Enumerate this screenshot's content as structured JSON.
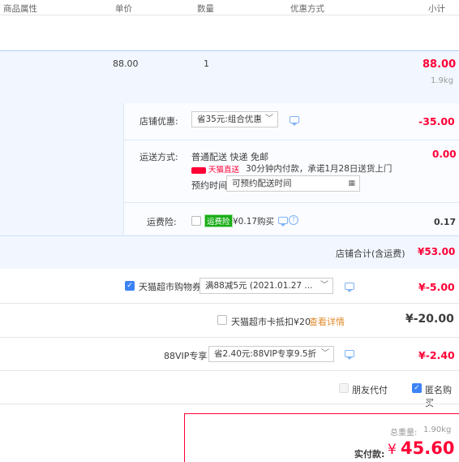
{
  "header": {
    "col_attr": "商品属性",
    "col_price": "单价",
    "col_qty": "数量",
    "col_promo": "优惠方式",
    "col_subtotal": "小计"
  },
  "item": {
    "price": "88.00",
    "qty": "1",
    "subtotal": "88.00",
    "weight": "1.9kg"
  },
  "shop": {
    "discount_label": "店铺优惠:",
    "discount_select": "省35元:组合优惠",
    "discount_amount": "-35.00",
    "shipping_label": "运送方式:",
    "shipping_text": "普通配送 快递 免邮",
    "shipping_amount": "0.00",
    "tmall_badge": "天猫直送",
    "tmall_text": "30分钟内付款，承诺1月28日送货上门",
    "reserve_label": "预约时间",
    "reserve_placeholder": "可预约配送时间",
    "insurance_label": "运费险:",
    "insurance_tag": "运费险",
    "insurance_text": "¥0.17购买",
    "insurance_amount": "0.17",
    "total_label": "店铺合计(含运费)",
    "total_amount": "¥53.00"
  },
  "coupon": {
    "label": "天猫超市购物券",
    "select": "满88减5元 (2021.01.27 ...",
    "amount": "¥-5.00",
    "checked": true
  },
  "card": {
    "label": "天猫超市卡抵扣¥20",
    "link": "查看详情",
    "amount": "¥-20.00"
  },
  "vip": {
    "label": "88VIP专享",
    "select": "省2.40元:88VIP专享9.5折",
    "amount": "¥-2.40"
  },
  "options": {
    "friend_pay": "朋友代付",
    "anon_buy": "匿名购买"
  },
  "summary": {
    "weight_label": "总重量:",
    "weight_value": "1.90kg",
    "pay_label": "实付款:",
    "currency": "¥",
    "pay_value": "45.60"
  },
  "colors": {
    "accent_red": "#ff0036",
    "accent_blue": "#3d82f5",
    "band_blue": "#f2f7ff"
  }
}
